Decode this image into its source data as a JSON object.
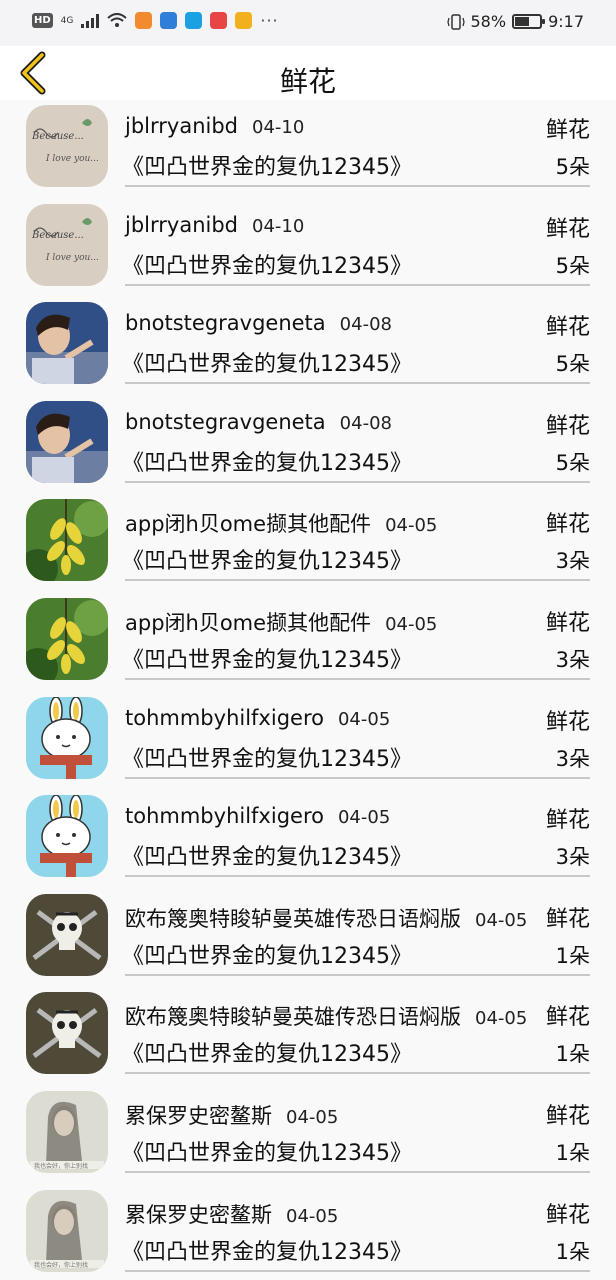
{
  "status": {
    "hd": "HD",
    "network": "4G",
    "battery_percent": "58%",
    "battery_level": 0.58,
    "time": "9:17",
    "more": "···",
    "app_icon_colors": [
      "#f28b2e",
      "#2f7fd8",
      "#1ba1e2",
      "#e84545",
      "#f2b01e"
    ]
  },
  "header": {
    "title": "鲜花"
  },
  "list": [
    {
      "name": "jblrryanibd",
      "date": "04-10",
      "type": "鲜花",
      "book": "《凹凸世界金的复仇12345》",
      "count": "5朵",
      "avatar": "handwriting"
    },
    {
      "name": "jblrryanibd",
      "date": "04-10",
      "type": "鲜花",
      "book": "《凹凸世界金的复仇12345》",
      "count": "5朵",
      "avatar": "handwriting"
    },
    {
      "name": "bnotstegravgeneta",
      "date": "04-08",
      "type": "鲜花",
      "book": "《凹凸世界金的复仇12345》",
      "count": "5朵",
      "avatar": "boy"
    },
    {
      "name": "bnotstegravgeneta",
      "date": "04-08",
      "type": "鲜花",
      "book": "《凹凸世界金的复仇12345》",
      "count": "5朵",
      "avatar": "boy"
    },
    {
      "name": "app闭h贝ome撷其他配件",
      "date": "04-05",
      "type": "鲜花",
      "book": "《凹凸世界金的复仇12345》",
      "count": "3朵",
      "avatar": "flowers"
    },
    {
      "name": "app闭h贝ome撷其他配件",
      "date": "04-05",
      "type": "鲜花",
      "book": "《凹凸世界金的复仇12345》",
      "count": "3朵",
      "avatar": "flowers"
    },
    {
      "name": "tohmmbyhilfxigero",
      "date": "04-05",
      "type": "鲜花",
      "book": "《凹凸世界金的复仇12345》",
      "count": "3朵",
      "avatar": "bunny"
    },
    {
      "name": "tohmmbyhilfxigero",
      "date": "04-05",
      "type": "鲜花",
      "book": "《凹凸世界金的复仇12345》",
      "count": "3朵",
      "avatar": "bunny"
    },
    {
      "name": "欧布篾奥特睃轳曼英雄传恐日语焖版",
      "date": "04-05",
      "type": "鲜花",
      "book": "《凹凸世界金的复仇12345》",
      "count": "1朵",
      "avatar": "skull"
    },
    {
      "name": "欧布篾奥特睃轳曼英雄传恐日语焖版",
      "date": "04-05",
      "type": "鲜花",
      "book": "《凹凸世界金的复仇12345》",
      "count": "1朵",
      "avatar": "skull"
    },
    {
      "name": "累保罗史密鳌斯",
      "date": "04-05",
      "type": "鲜花",
      "book": "《凹凸世界金的复仇12345》",
      "count": "1朵",
      "avatar": "girl"
    },
    {
      "name": "累保罗史密鳌斯",
      "date": "04-05",
      "type": "鲜花",
      "book": "《凹凸世界金的复仇12345》",
      "count": "1朵",
      "avatar": "girl"
    }
  ]
}
